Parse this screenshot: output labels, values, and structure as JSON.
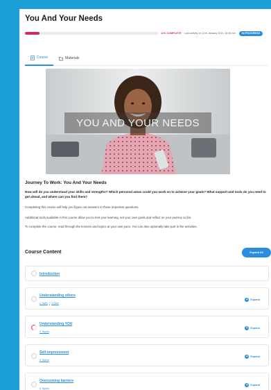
{
  "page": {
    "title": "You And Your Needs"
  },
  "progress": {
    "percent": 11,
    "label": "11% COMPLETE",
    "last_activity": "Last activity on 11th January 2021 10:06 am",
    "status": "IN PROGRESS"
  },
  "tabs": [
    {
      "label": "Course",
      "icon": "document-icon",
      "active": true
    },
    {
      "label": "Materials",
      "icon": "folder-icon",
      "active": false
    }
  ],
  "hero": {
    "overlay_text": "YOU AND YOUR NEEDS"
  },
  "description": {
    "heading": "Journey To Work: You And Your Needs",
    "bold_paragraph": "How will do you understand your skills and strengths? Which personal areas could you work on to achieve your goals? What support and tools do you need to get ahead, and where can you find them?",
    "paragraphs": [
      "Completing this course will help you figure out answers to these important questions.",
      "Additional tools available in this course allow you to test your learning, set your own goals and reflect on your journey so far.",
      "To complete the course, read through the lessons and topics at your own pace. You can also optionally take part in the activities."
    ]
  },
  "course_content": {
    "heading": "Course Content",
    "expand_all_label": "Expand All",
    "lessons": [
      {
        "name": "Introduction"
      },
      {
        "name": "Understanding others",
        "topics": "1 Topic",
        "quiz": "1 Quiz",
        "expand_label": "Expand"
      },
      {
        "name": "Understanding YOU",
        "topics": "3 Topics",
        "expand_label": "Expand",
        "in_progress": true
      },
      {
        "name": "Self-improvement",
        "topics": "3 Topics",
        "expand_label": "Expand"
      },
      {
        "name": "Overcoming barriers",
        "topics": "4 Topics",
        "expand_label": "Expand"
      }
    ]
  },
  "colors": {
    "frame": "#1c9fd6",
    "accent_blue": "#2a8ee0",
    "progress_pink": "#d0296c"
  }
}
